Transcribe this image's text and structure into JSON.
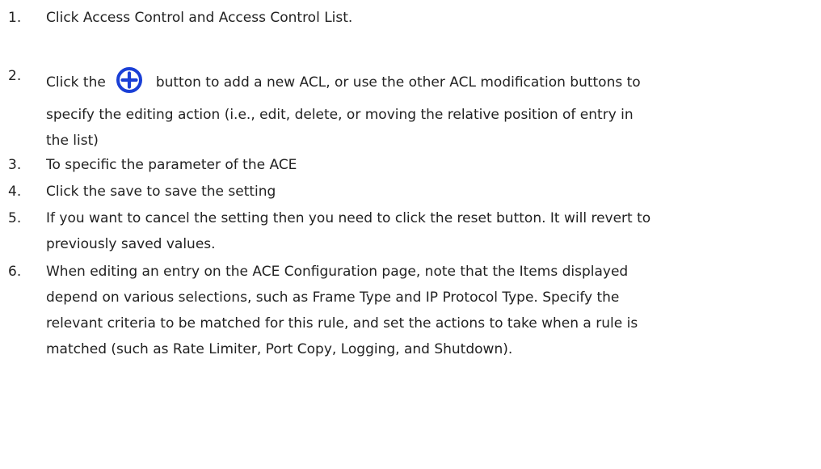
{
  "steps": [
    {
      "number": "1.",
      "text": "Click Access Control and Access Control List."
    },
    {
      "number": "2.",
      "text_before_icon": "Click the",
      "icon": "add-circle-icon",
      "icon_color": "#1a3fd6",
      "text_after_icon": "button to add a new ACL, or use the other ACL modification buttons to",
      "line2": "specify the editing action (i.e., edit, delete, or moving the relative position of entry in",
      "line3": "the list)"
    },
    {
      "number": "3.",
      "text": "To specific the parameter of the ACE"
    },
    {
      "number": "4.",
      "text": "Click the save to save the setting"
    },
    {
      "number": "5.",
      "line1": "If you want to cancel the setting then you need to click the reset button. It will revert to",
      "line2": "previously saved values."
    },
    {
      "number": "6.",
      "line1": "When editing an entry on the ACE Configuration page, note that the Items displayed",
      "line2": "depend on various selections, such as Frame Type and IP Protocol Type. Specify the",
      "line3": "relevant criteria to be matched for this rule, and set the actions to take when a rule is",
      "line4": "matched (such as Rate Limiter, Port Copy, Logging, and Shutdown)."
    }
  ]
}
